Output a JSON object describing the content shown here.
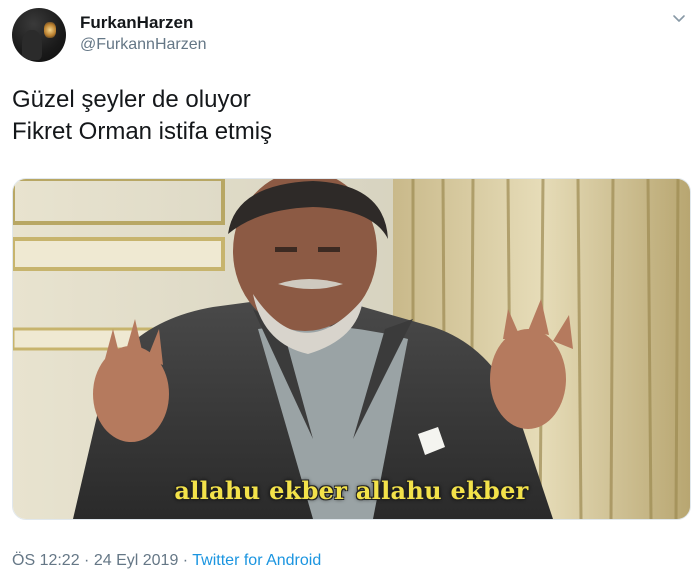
{
  "author": {
    "display_name": "FurkanHarzen",
    "handle": "@FurkannHarzen"
  },
  "tweet": {
    "lines": [
      "Güzel şeyler de oluyor",
      "Fikret Orman istifa etmiş"
    ]
  },
  "media": {
    "subtitle": "allahu ekber allahu ekber"
  },
  "meta": {
    "time": "ÖS 12:22",
    "separator1": " · ",
    "date": "24 Eyl 2019",
    "separator2": " · ",
    "source": "Twitter for Android"
  },
  "icons": {
    "caret": "chevron-down-icon"
  },
  "colors": {
    "link": "#1b95e0",
    "secondary_text": "#657786",
    "subtitle_text": "#f3e24a"
  }
}
